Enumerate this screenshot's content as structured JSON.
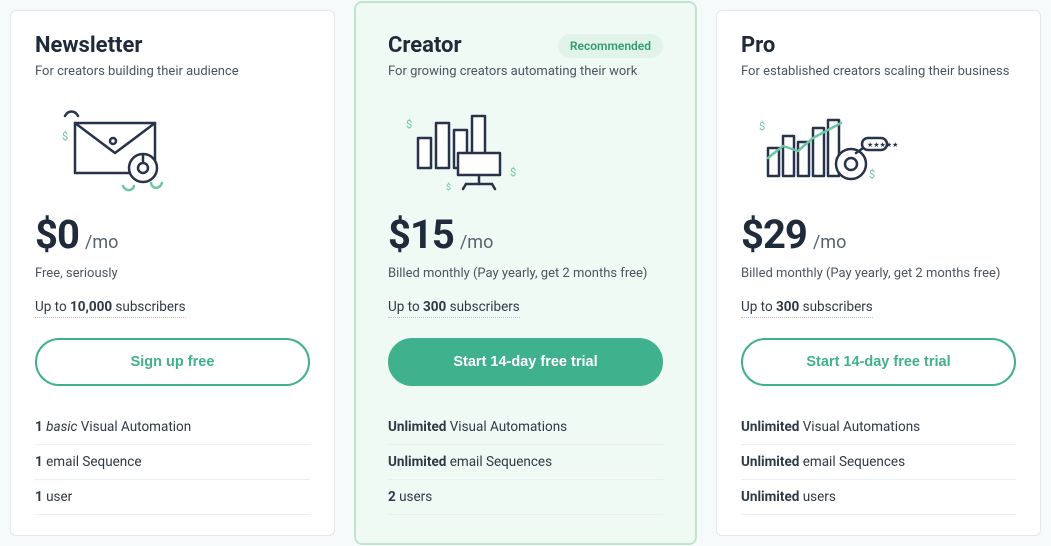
{
  "plans": [
    {
      "key": "newsletter",
      "title": "Newsletter",
      "subtitle": "For creators building their audience",
      "badge": "",
      "price": "$0",
      "per": "/mo",
      "billing_note": "Free, seriously",
      "subs_prefix": "Up to ",
      "subs_bold": "10,000",
      "subs_suffix": " subscribers",
      "cta": "Sign up free",
      "cta_style": "outline",
      "features": [
        {
          "bold": "1",
          "italic": "basic",
          "rest": " Visual Automation"
        },
        {
          "bold": "1",
          "italic": "",
          "rest": " email Sequence"
        },
        {
          "bold": "1",
          "italic": "",
          "rest": " user"
        }
      ]
    },
    {
      "key": "creator",
      "title": "Creator",
      "subtitle": "For growing creators automating their work",
      "badge": "Recommended",
      "price": "$15",
      "per": "/mo",
      "billing_note": "Billed monthly (Pay yearly, get 2 months free)",
      "subs_prefix": "Up to ",
      "subs_bold": "300",
      "subs_suffix": " subscribers",
      "cta": "Start 14-day free trial",
      "cta_style": "solid",
      "features": [
        {
          "bold": "Unlimited",
          "italic": "",
          "rest": " Visual Automations"
        },
        {
          "bold": "Unlimited",
          "italic": "",
          "rest": " email Sequences"
        },
        {
          "bold": "2",
          "italic": "",
          "rest": " users"
        }
      ]
    },
    {
      "key": "pro",
      "title": "Pro",
      "subtitle": "For established creators scaling their business",
      "badge": "",
      "price": "$29",
      "per": "/mo",
      "billing_note": "Billed monthly (Pay yearly, get 2 months free)",
      "subs_prefix": "Up to ",
      "subs_bold": "300",
      "subs_suffix": " subscribers",
      "cta": "Start 14-day free trial",
      "cta_style": "outline",
      "features": [
        {
          "bold": "Unlimited",
          "italic": "",
          "rest": " Visual Automations"
        },
        {
          "bold": "Unlimited",
          "italic": "",
          "rest": " email Sequences"
        },
        {
          "bold": "Unlimited",
          "italic": "",
          "rest": " users"
        }
      ]
    }
  ]
}
